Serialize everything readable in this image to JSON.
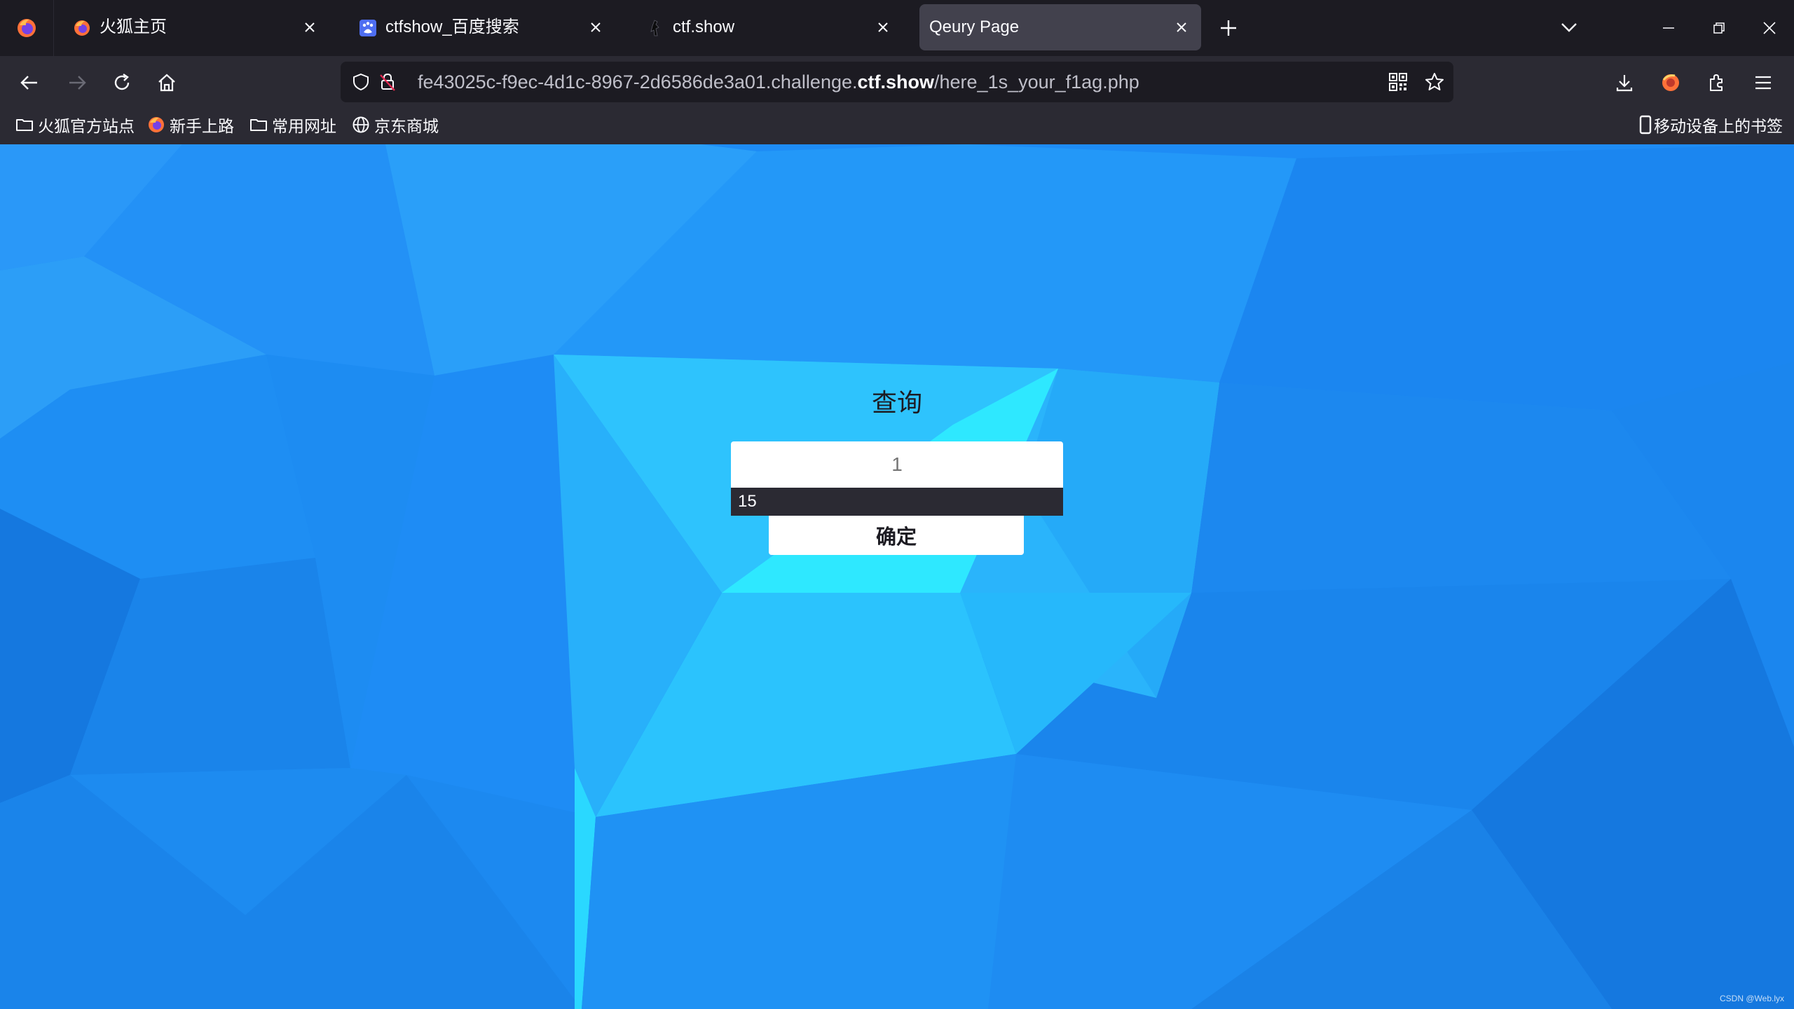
{
  "browser": {
    "tabs": [
      {
        "title": "火狐主页",
        "icon": "firefox-icon",
        "active": false
      },
      {
        "title": "ctfshow_百度搜索",
        "icon": "baidu-icon",
        "active": false
      },
      {
        "title": "ctf.show",
        "icon": "ctfshow-icon",
        "active": false
      },
      {
        "title": "Qeury Page",
        "icon": "",
        "active": true
      }
    ],
    "url": {
      "prefix": "fe43025c-f9ec-4d1c-8967-2d6586de3a01.challenge.",
      "domain": "ctf.show",
      "path": "/here_1s_your_f1ag.php"
    },
    "bookmarks": [
      {
        "label": "火狐官方站点",
        "icon": "folder-icon"
      },
      {
        "label": "新手上路",
        "icon": "firefox-icon"
      },
      {
        "label": "常用网址",
        "icon": "folder-icon"
      },
      {
        "label": "京东商城",
        "icon": "globe-icon"
      }
    ],
    "mobile_bookmarks": "移动设备上的书签"
  },
  "page": {
    "heading": "查询",
    "input_placeholder": "1",
    "input_value": "",
    "autocomplete_suggestion": "15",
    "submit_label": "确定",
    "watermark": "CSDN @Web.lyx"
  },
  "colors": {
    "browser_dark": "#1c1b22",
    "toolbar": "#2b2a33",
    "active_tab": "#42414d",
    "page_blue": "#1e8cf5",
    "page_cyan": "#2ee8ff"
  }
}
